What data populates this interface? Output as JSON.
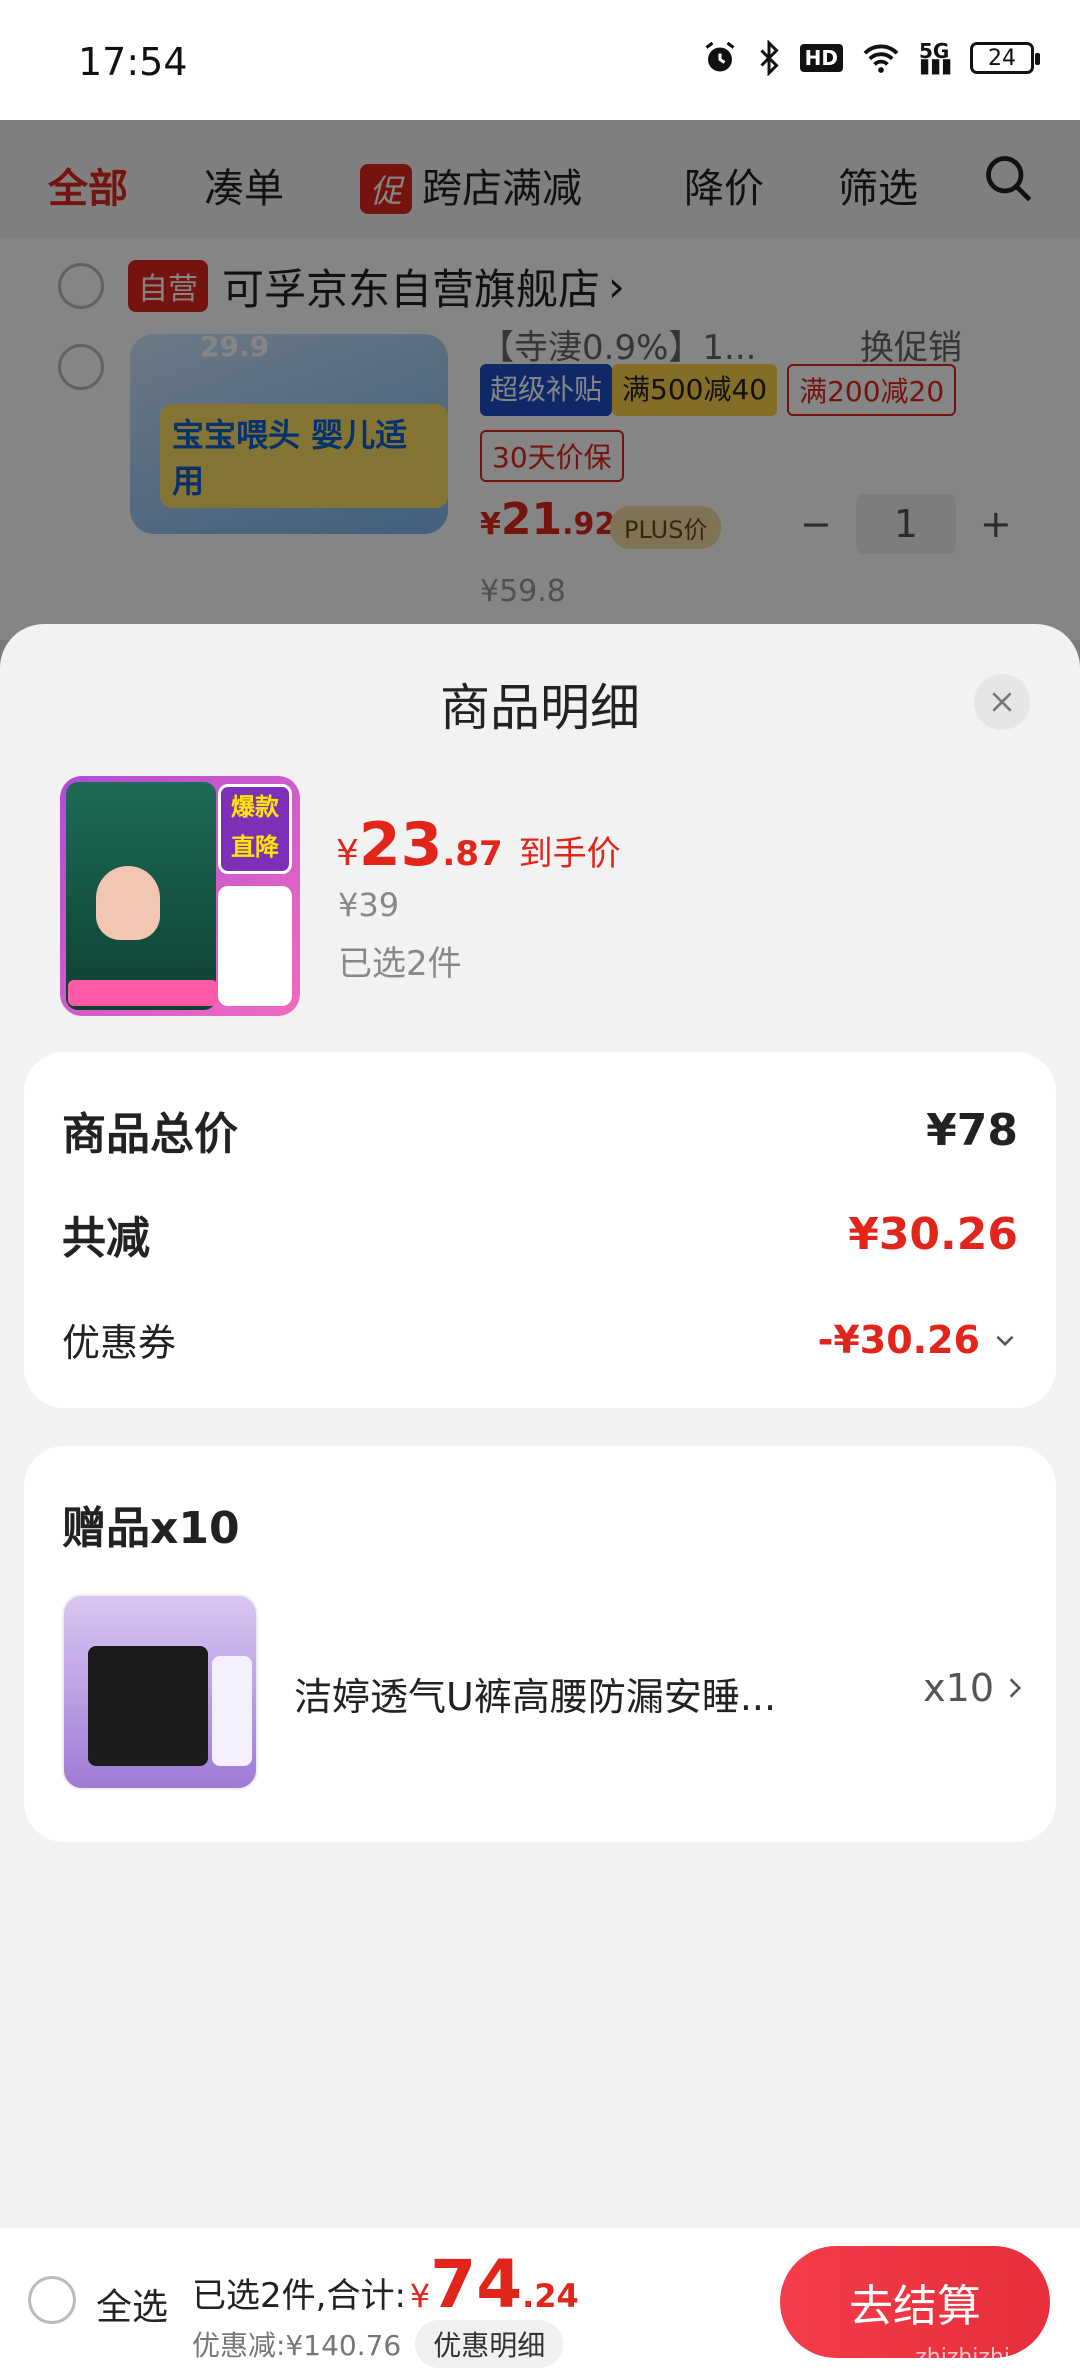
{
  "status_bar": {
    "time": "17:54",
    "battery": "24",
    "network": "5G",
    "hd": "HD",
    "icons": [
      "alarm-icon",
      "bluetooth-icon",
      "hd-icon",
      "wifi-icon",
      "signal-icon",
      "battery-icon"
    ]
  },
  "cart_tabs": {
    "all": "全部",
    "combine": "凑单",
    "promo_badge": "促",
    "cross_store": "跨店满减",
    "price_drop": "降价",
    "filter": "筛选"
  },
  "store": {
    "badge": "自营",
    "name": "可孚京东自营旗舰店",
    "chevron": "›"
  },
  "bg_item": {
    "thumb_tag": "宝宝喂头 婴儿适用",
    "thumb_price": "29.9",
    "spec": "【寺淒0.9%】1...",
    "promo_select": "换促销",
    "chips": [
      "超级补贴",
      "满500减40",
      "满200减20",
      "30天价保"
    ],
    "price_cur": "¥",
    "price_int": "21",
    "price_dec": ".92",
    "plus_label": "PLUS价",
    "quantity": "1",
    "minus": "−",
    "plus": "+",
    "orig_partial": "¥59.8"
  },
  "sheet": {
    "title": "商品明细",
    "close_icon": "close-icon"
  },
  "product": {
    "img_badge": "爆款直降",
    "price_cur": "¥",
    "price_int": "23",
    "price_dec": ".87",
    "price_label": "到手价",
    "orig_price": "¥39",
    "selected": "已选2件"
  },
  "summary": {
    "total_label": "商品总价",
    "total_value": "¥78",
    "reduce_label": "共减",
    "reduce_value": "¥30.26",
    "coupon_label": "优惠券",
    "coupon_value": "-¥30.26"
  },
  "gift": {
    "title": "赠品x10",
    "name": "洁婷透气U裤高腰防漏安睡...",
    "qty": "x10"
  },
  "bottom_bar": {
    "select_all": "全选",
    "selected_text": "已选2件,合计:",
    "total_cur": "¥",
    "total_int": "74",
    "total_dec": ".24",
    "discount_text": "优惠减:¥140.76",
    "detail_button": "优惠明细",
    "checkout": "去结算",
    "watermark": "zhizhizhi.com"
  },
  "colors": {
    "accent": "#e1251b",
    "checkout": "#f43c4a",
    "sheet_bg": "#f2f2f2"
  }
}
